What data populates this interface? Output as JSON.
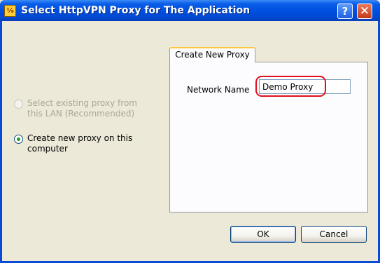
{
  "window": {
    "title": "Select HttpVPN Proxy for The Application",
    "app_icon_glyph": "⅑",
    "help_glyph": "?",
    "close_glyph": "✕"
  },
  "options": {
    "existing_proxy_label": "Select existing proxy from this LAN (Recommended)",
    "existing_proxy_enabled": false,
    "existing_proxy_selected": false,
    "new_proxy_label": "Create new proxy on this computer",
    "new_proxy_selected": true
  },
  "tab": {
    "label": "Create New Proxy"
  },
  "form": {
    "network_name_label": "Network Name",
    "network_name_value": "Demo Proxy"
  },
  "buttons": {
    "ok_label": "OK",
    "cancel_label": "Cancel"
  },
  "colors": {
    "titlebar": "#0050e0",
    "highlight_ring": "#e0101a",
    "radio_checked": "#21a121",
    "dialog_bg": "#ece9d8"
  }
}
